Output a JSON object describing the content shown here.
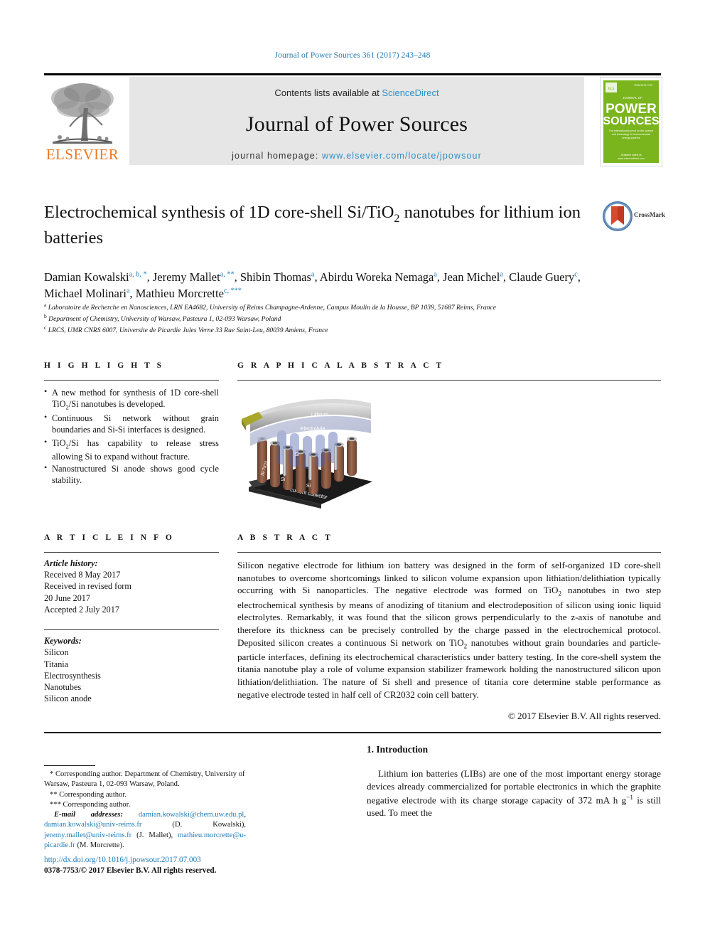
{
  "running_head": "Journal of Power Sources 361 (2017) 243–248",
  "masthead": {
    "contents_prefix": "Contents lists available at ",
    "sciencedirect": "ScienceDirect",
    "journal_title": "Journal of Power Sources",
    "homepage_label": "journal homepage: ",
    "homepage_url": "www.elsevier.com/locate/jpowsour",
    "publisher_logo_text": "ELSEVIER",
    "cover": {
      "line1": "JOURNAL OF",
      "line2": "POWER",
      "line3": "SOURCES",
      "tagline": "The international journal on the science and technology of electrochemical energy systems",
      "bg_color": "#7ab51d"
    }
  },
  "crossmark": {
    "label": "CrossMark"
  },
  "article": {
    "title_part1": "Electrochemical synthesis of 1D core-shell Si/TiO",
    "title_sub": "2",
    "title_part2": " nanotubes for lithium ion batteries",
    "authors": [
      {
        "name": "Damian Kowalski",
        "marks": "a, b, *",
        "sep": ", "
      },
      {
        "name": "Jeremy Mallet",
        "marks": "a, **",
        "sep": ", "
      },
      {
        "name": "Shibin Thomas",
        "marks": "a",
        "sep": ", "
      },
      {
        "name": "Abirdu Woreka Nemaga",
        "marks": "a",
        "sep": ", "
      },
      {
        "name": "Jean Michel",
        "marks": "a",
        "sep": ", "
      },
      {
        "name": "Claude Guery",
        "marks": "c",
        "sep": ", "
      },
      {
        "name": "Michael Molinari",
        "marks": "a",
        "sep": ", "
      },
      {
        "name": "Mathieu Morcrette",
        "marks": "c, ***",
        "sep": ""
      }
    ],
    "affiliations": [
      {
        "mark": "a",
        "text": "Laboratoire de Recherche en Nanosciences, LRN EA4682, University of Reims Champagne-Ardenne, Campus Moulin de la Housse, BP 1039, 51687 Reims, France"
      },
      {
        "mark": "b",
        "text": "Department of Chemistry, University of Warsaw, Pasteura 1, 02-093 Warsaw, Poland"
      },
      {
        "mark": "c",
        "text": "LRCS, UMR CNRS 6007, Universite de Picardie Jules Verne 33 Rue Saint-Leu, 80039 Amiens, France"
      }
    ]
  },
  "highlights": {
    "heading": "H I G H L I G H T S",
    "items": [
      {
        "pre": "A new method for synthesis of 1D core-shell TiO",
        "sub": "2",
        "post": "/Si nanotubes is developed."
      },
      {
        "pre": "Continuous Si network without grain boundaries and Si-Si interfaces is designed.",
        "sub": "",
        "post": ""
      },
      {
        "pre": "TiO",
        "sub": "2",
        "post": "/Si has capability to release stress allowing Si to expand without fracture."
      },
      {
        "pre": "Nanostructured Si anode shows good cycle stability.",
        "sub": "",
        "post": ""
      }
    ]
  },
  "graphical_abstract": {
    "heading": "G R A P H I C A L   A B S T R A C T",
    "figure_labels": {
      "lithium": "Lithium",
      "electrolyte": "Electrolyte",
      "si": "Si",
      "si_tio2": "Si/TiO₂",
      "current_collector": "current collector"
    }
  },
  "article_info": {
    "heading": "A R T I C L E   I N F O",
    "history_label": "Article history:",
    "history": [
      "Received 8 May 2017",
      "Received in revised form",
      "20 June 2017",
      "Accepted 2 July 2017"
    ],
    "keywords_label": "Keywords:",
    "keywords": [
      "Silicon",
      "Titania",
      "Electrosynthesis",
      "Nanotubes",
      "Silicon anode"
    ]
  },
  "abstract": {
    "heading": "A B S T R A C T",
    "p1": "Silicon negative electrode for lithium ion battery was designed in the form of self-organized 1D core-shell nanotubes to overcome shortcomings linked to silicon volume expansion upon lithiation/delithiation typically occurring with Si nanoparticles. The negative electrode was formed on TiO",
    "p1_sub": "2",
    "p2": " nanotubes in two step electrochemical synthesis by means of anodizing of titanium and electrodeposition of silicon using ionic liquid electrolytes. Remarkably, it was found that the silicon grows perpendicularly to the z-axis of nanotube and therefore its thickness can be precisely controlled by the charge passed in the electrochemical protocol. Deposited silicon creates a continuous Si network on TiO",
    "p2_sub": "2",
    "p3": " nanotubes without grain boundaries and particle-particle interfaces, defining its electrochemical characteristics under battery testing. In the core-shell system the titania nanotube play a role of volume expansion stabilizer framework holding the nanostructured silicon upon lithiation/delithiation. The nature of Si shell and presence of titania core determine stable performance as negative electrode tested in half cell of CR2032 coin cell battery.",
    "copyright": "© 2017 Elsevier B.V. All rights reserved."
  },
  "footnotes": {
    "corr1": "* Corresponding author. Department of Chemistry, University of Warsaw, Pasteura 1, 02-093 Warsaw, Poland.",
    "corr2": "** Corresponding author.",
    "corr3": "*** Corresponding author.",
    "emails_label": "E-mail addresses:",
    "emails": [
      {
        "addr": "damian.kowalski@chem.uw.edu.pl",
        "tail": ", "
      },
      {
        "addr": "damian.kowalski@univ-reims.fr",
        "tail": " (D. Kowalski), "
      },
      {
        "addr": "jeremy.mallet@univ-reims.fr",
        "tail": " (J. Mallet), "
      },
      {
        "addr": "mathieu.morcrette@u-picardie.fr",
        "tail": " (M. Morcrette)."
      }
    ]
  },
  "doi_block": {
    "doi": "http://dx.doi.org/10.1016/j.jpowsour.2017.07.003",
    "issn_line": "0378-7753/© 2017 Elsevier B.V. All rights reserved."
  },
  "introduction": {
    "heading": "1. Introduction",
    "p1_a": "Lithium ion batteries (LIBs) are one of the most important energy storage devices already commercialized for portable electronics in which the graphite negative electrode with its charge storage capacity of 372 mA h g",
    "p1_sup": "−1",
    "p1_b": " is still used. To meet the"
  },
  "colors": {
    "link": "#1f7bb6",
    "elsevier_orange": "#E87722",
    "masthead_bg": "#e6e6e6",
    "cover_green": "#7ab51d"
  }
}
